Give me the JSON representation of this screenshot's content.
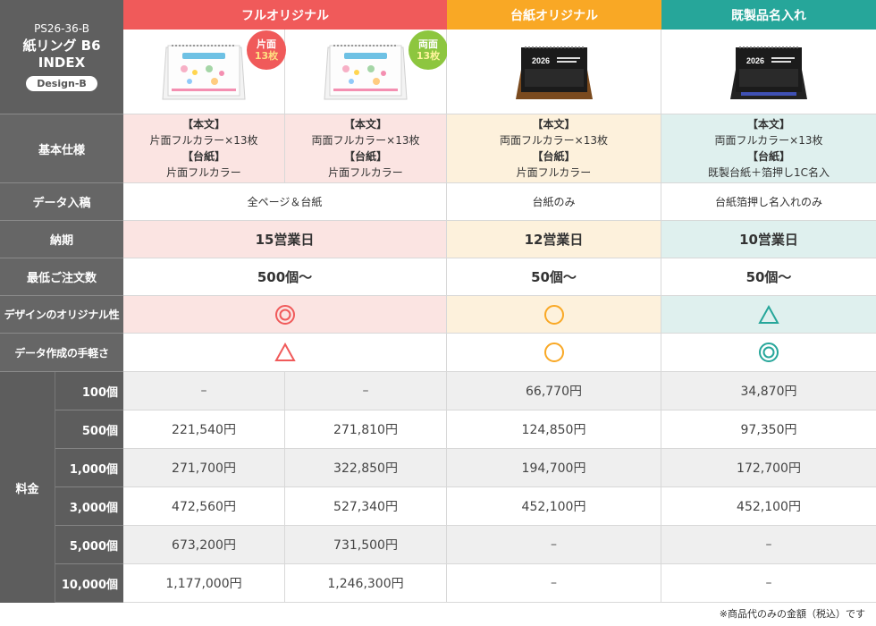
{
  "header": {
    "code": "PS26-36-B",
    "product_line1": "紙リング B6",
    "product_line2": "INDEX",
    "design": "Design-B"
  },
  "columns": {
    "full_original": "フルオリジナル",
    "mount_original": "台紙オリジナル",
    "ready_made": "既製品名入れ"
  },
  "badges": {
    "single": {
      "line1": "片面",
      "line2": "13枚",
      "color": "#f05a5a"
    },
    "double": {
      "line1": "両面",
      "line2": "13枚",
      "color": "#8dc63f"
    }
  },
  "colors": {
    "red": "#f05a5a",
    "orange": "#f9a825",
    "teal": "#26a69a",
    "gray_header": "#666666"
  },
  "rows": {
    "spec": {
      "label": "基本仕様",
      "c1": {
        "h1": "【本文】",
        "t1": "片面フルカラー×13枚",
        "h2": "【台紙】",
        "t2": "片面フルカラー"
      },
      "c2": {
        "h1": "【本文】",
        "t1": "両面フルカラー×13枚",
        "h2": "【台紙】",
        "t2": "片面フルカラー"
      },
      "c3": {
        "h1": "【本文】",
        "t1": "両面フルカラー×13枚",
        "h2": "【台紙】",
        "t2": "片面フルカラー"
      },
      "c4": {
        "h1": "【本文】",
        "t1": "両面フルカラー×13枚",
        "h2": "【台紙】",
        "t2": "既製台紙＋箔押し1C名入"
      }
    },
    "data": {
      "label": "データ入稿",
      "full": "全ページ＆台紙",
      "mount": "台紙のみ",
      "ready": "台紙箔押し名入れのみ"
    },
    "delivery": {
      "label": "納期",
      "full": "15営業日",
      "mount": "12営業日",
      "ready": "10営業日"
    },
    "minimum": {
      "label": "最低ご注文数",
      "full": "500個〜",
      "mount": "50個〜",
      "ready": "50個〜"
    },
    "originality": {
      "label": "デザインのオリジナル性",
      "full": "double-circle",
      "mount": "circle",
      "ready": "triangle"
    },
    "ease": {
      "label": "データ作成の手軽さ",
      "full": "triangle",
      "mount": "circle",
      "ready": "double-circle"
    }
  },
  "pricing": {
    "label": "料金",
    "rows": [
      {
        "qty": "100個",
        "c1": "–",
        "c2": "–",
        "c3": "66,770円",
        "c4": "34,870円"
      },
      {
        "qty": "500個",
        "c1": "221,540円",
        "c2": "271,810円",
        "c3": "124,850円",
        "c4": "97,350円"
      },
      {
        "qty": "1,000個",
        "c1": "271,700円",
        "c2": "322,850円",
        "c3": "194,700円",
        "c4": "172,700円"
      },
      {
        "qty": "3,000個",
        "c1": "472,560円",
        "c2": "527,340円",
        "c3": "452,100円",
        "c4": "452,100円"
      },
      {
        "qty": "5,000個",
        "c1": "673,200円",
        "c2": "731,500円",
        "c3": "–",
        "c4": "–"
      },
      {
        "qty": "10,000個",
        "c1": "1,177,000円",
        "c2": "1,246,300円",
        "c3": "–",
        "c4": "–"
      }
    ]
  },
  "calendar_year": "2026",
  "footnote": "※商品代のみの金額（税込）です"
}
